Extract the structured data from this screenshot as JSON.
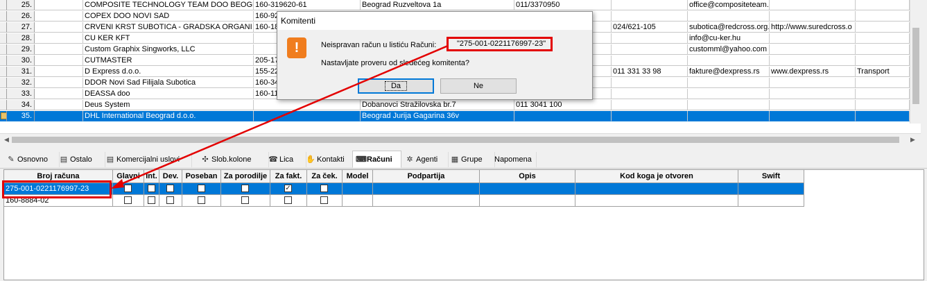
{
  "komitenti": [
    {
      "num": "25.",
      "name": "COMPOSITE TECHNOLOGY TEAM DOO BEOGRAD (",
      "acct": "160-319620-61",
      "addr": "Beograd Ruzveltova 1a",
      "phone": "011/3370950",
      "fax": "",
      "email": "office@compositeteam.c",
      "web": "",
      "type": ""
    },
    {
      "num": "26.",
      "name": "COPEX DOO NOVI SAD",
      "acct": "160-92",
      "addr": "",
      "phone": "",
      "fax": "",
      "email": "",
      "web": "",
      "type": ""
    },
    {
      "num": "27.",
      "name": "CRVENI KRST SUBOTICA - GRADSKA ORGANI",
      "acct": "160-18",
      "addr": "",
      "phone": "",
      "fax": "024/621-105",
      "email": "subotica@redcross.org.",
      "web": "http://www.suredcross.o",
      "type": ""
    },
    {
      "num": "28.",
      "name": "CU KER KFT",
      "acct": "",
      "addr": "",
      "phone": "",
      "fax": "",
      "email": "info@cu-ker.hu",
      "web": "",
      "type": ""
    },
    {
      "num": "29.",
      "name": "Custom Graphix Singworks, LLC",
      "acct": "",
      "addr": "",
      "phone": "",
      "fax": "",
      "email": "customml@yahoo.com",
      "web": "",
      "type": ""
    },
    {
      "num": "30.",
      "name": "CUTMASTER",
      "acct": "205-17",
      "addr": "",
      "phone": "",
      "fax": "",
      "email": "",
      "web": "",
      "type": ""
    },
    {
      "num": "31.",
      "name": "D Express d.o.o.",
      "acct": "155-22",
      "addr": "",
      "phone": "",
      "fax": "011 331 33 98",
      "email": "fakture@dexpress.rs",
      "web": "www.dexpress.rs",
      "type": "Transport"
    },
    {
      "num": "32.",
      "name": "DDOR Novi Sad Filijala Subotica",
      "acct": "160-34",
      "addr": "",
      "phone": "",
      "fax": "",
      "email": "",
      "web": "",
      "type": ""
    },
    {
      "num": "33.",
      "name": "DEASSA doo",
      "acct": "160-11",
      "addr": "",
      "phone": "",
      "fax": "",
      "email": "",
      "web": "",
      "type": ""
    },
    {
      "num": "34.",
      "name": "Deus System",
      "acct": "",
      "addr": "Dobanovci Stražilovska br.7",
      "phone": "011 3041 100",
      "fax": "",
      "email": "",
      "web": "",
      "type": ""
    },
    {
      "num": "35.",
      "name": "DHL International Beograd d.o.o.",
      "acct": "",
      "addr": "Beograd Jurija Gagarina 36v",
      "phone": "",
      "fax": "",
      "email": "",
      "web": "",
      "type": ""
    }
  ],
  "tabs": [
    {
      "label": "Osnovno",
      "icon": "edit-icon"
    },
    {
      "label": "Ostalo",
      "icon": "document-icon"
    },
    {
      "label": "Komercijalni uslovi",
      "icon": "document-icon"
    },
    {
      "label": "Slob.kolone",
      "icon": "butterfly-icon"
    },
    {
      "label": "Lica",
      "icon": "phone-icon"
    },
    {
      "label": "Kontakti",
      "icon": "hand-icon"
    },
    {
      "label": "Računi",
      "icon": "keyboard-icon"
    },
    {
      "label": "Agenti",
      "icon": "gear-icon"
    },
    {
      "label": "Grupe",
      "icon": "grid-icon"
    },
    {
      "label": "Napomena",
      "icon": ""
    }
  ],
  "racuni": {
    "headers": [
      "Broj računa",
      "Glavni",
      "Int.",
      "Dev.",
      "Poseban",
      "Za porodilje",
      "Za fakt.",
      "Za ček.",
      "Model",
      "Podpartija",
      "Opis",
      "Kod koga je otvoren",
      "Swift"
    ],
    "rows": [
      {
        "broj": "275-001-0221176997-23",
        "glavni": false,
        "int": false,
        "dev": false,
        "poseban": false,
        "porodilje": false,
        "fakt": true,
        "cek": false
      },
      {
        "broj": "160-8884-02",
        "glavni": false,
        "int": false,
        "dev": false,
        "poseban": false,
        "porodilje": false,
        "fakt": false,
        "cek": false
      }
    ]
  },
  "dialog": {
    "title": "Komitenti",
    "message_prefix": "Neispravan račun u listiću Računi:",
    "account": "\"275-001-0221176997-23\"",
    "question": "Nastavljate proveru od sledećeg komitenta?",
    "yes": "Da",
    "no": "Ne"
  },
  "colors": {
    "selection": "#0078d7",
    "annotation": "#e30000",
    "warning": "#f07d1e"
  }
}
